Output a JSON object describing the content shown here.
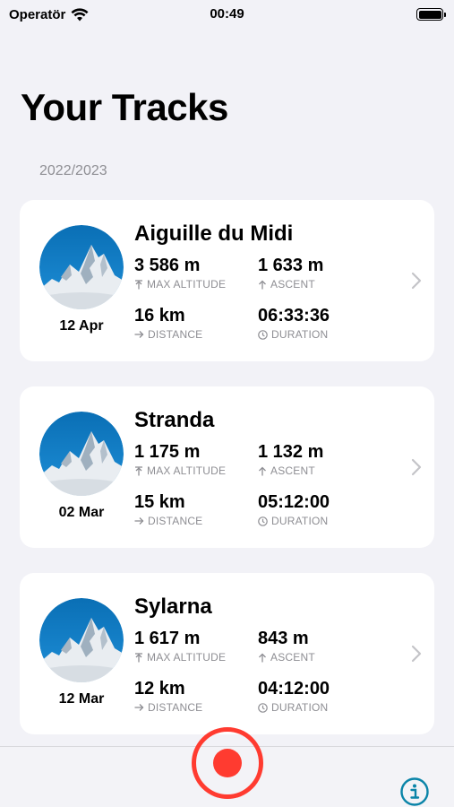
{
  "status_bar": {
    "carrier": "Operatör",
    "time": "00:49",
    "wifi_icon": "wifi-icon",
    "battery_icon": "battery-icon"
  },
  "page_title": "Your Tracks",
  "section_header": "2022/2023",
  "labels": {
    "max_altitude": "MAX ALTITUDE",
    "ascent": "ASCENT",
    "distance": "DISTANCE",
    "duration": "DURATION"
  },
  "tracks": [
    {
      "name": "Aiguille du Midi",
      "date": "12 Apr",
      "max_altitude": "3 586 m",
      "ascent": "1 633 m",
      "distance": "16 km",
      "duration": "06:33:36"
    },
    {
      "name": "Stranda",
      "date": "02 Mar",
      "max_altitude": "1 175 m",
      "ascent": "1 132 m",
      "distance": "15 km",
      "duration": "05:12:00"
    },
    {
      "name": "Sylarna",
      "date": "12 Mar",
      "max_altitude": "1 617 m",
      "ascent": "843 m",
      "distance": "12 km",
      "duration": "04:12:00"
    }
  ],
  "colors": {
    "accent_record": "#ff3b30",
    "info_icon": "#0a84a8",
    "secondary_text": "#8e8e93",
    "background": "#f2f2f7"
  },
  "icons": {
    "record": "record-icon",
    "info": "info-icon",
    "chevron": "chevron-right-icon",
    "mountain": "mountain-icon"
  }
}
